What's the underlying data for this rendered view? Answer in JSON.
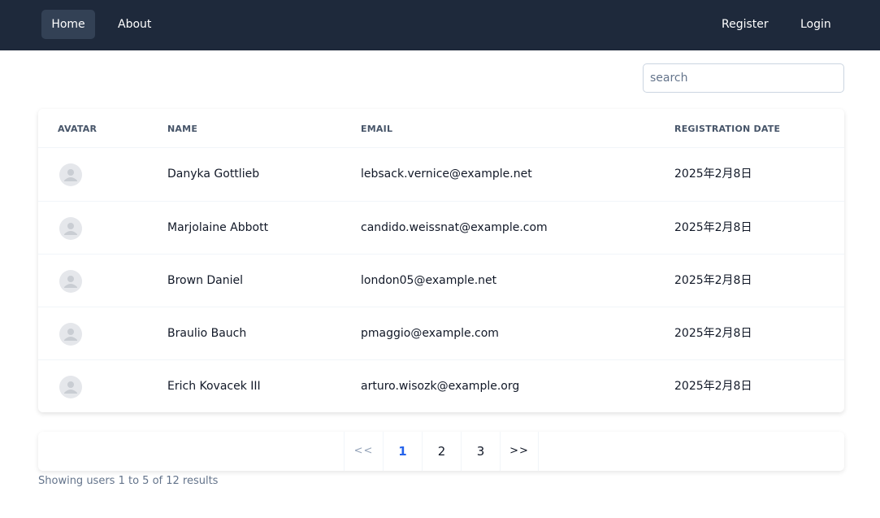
{
  "nav": {
    "home": "Home",
    "about": "About",
    "register": "Register",
    "login": "Login"
  },
  "search": {
    "placeholder": "search",
    "value": ""
  },
  "table": {
    "headers": [
      "AVATAR",
      "NAME",
      "EMAIL",
      "REGISTRATION DATE"
    ],
    "rows": [
      {
        "avatar": "user-avatar-icon",
        "name": "Danyka Gottlieb",
        "email": "lebsack.vernice@example.net",
        "date": "2025年2月8日"
      },
      {
        "avatar": "user-avatar-icon",
        "name": "Marjolaine Abbott",
        "email": "candido.weissnat@example.com",
        "date": "2025年2月8日"
      },
      {
        "avatar": "user-avatar-icon",
        "name": "Brown Daniel",
        "email": "london05@example.net",
        "date": "2025年2月8日"
      },
      {
        "avatar": "user-avatar-icon",
        "name": "Braulio Bauch",
        "email": "pmaggio@example.com",
        "date": "2025年2月8日"
      },
      {
        "avatar": "user-avatar-icon",
        "name": "Erich Kovacek III",
        "email": "arturo.wisozk@example.org",
        "date": "2025年2月8日"
      }
    ]
  },
  "pagination": {
    "prev": "<<",
    "pages": [
      "1",
      "2",
      "3"
    ],
    "current": "1",
    "next": ">>"
  },
  "summary": "Showing users 1 to 5 of 12 results",
  "colors": {
    "navbar": "#1e293b",
    "active_nav": "#334155",
    "active_page": "#2563eb",
    "muted_text": "#64748b"
  }
}
